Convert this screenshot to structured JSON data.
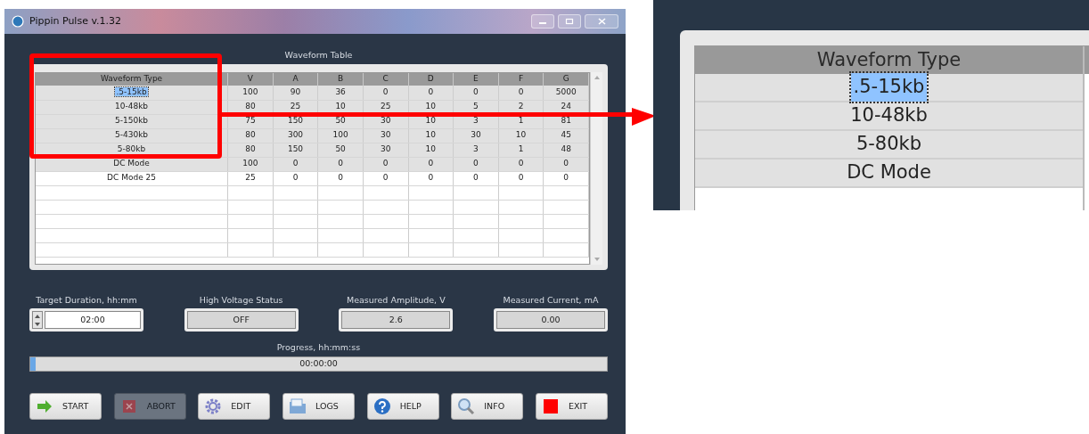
{
  "window": {
    "title": "Pippin Pulse v.1.32"
  },
  "waveform_table": {
    "title": "Waveform Table",
    "columns": [
      "Waveform Type",
      "V",
      "A",
      "B",
      "C",
      "D",
      "E",
      "F",
      "G"
    ],
    "rows": [
      {
        "cells": [
          ".5-15kb",
          "100",
          "90",
          "36",
          "0",
          "0",
          "0",
          "0",
          "5000"
        ],
        "selected": true,
        "shaded": true
      },
      {
        "cells": [
          "10-48kb",
          "80",
          "25",
          "10",
          "25",
          "10",
          "5",
          "2",
          "24"
        ],
        "selected": false,
        "shaded": true
      },
      {
        "cells": [
          "5-150kb",
          "75",
          "150",
          "50",
          "30",
          "10",
          "3",
          "1",
          "81"
        ],
        "selected": false,
        "shaded": true
      },
      {
        "cells": [
          "5-430kb",
          "80",
          "300",
          "100",
          "30",
          "10",
          "30",
          "10",
          "45"
        ],
        "selected": false,
        "shaded": true
      },
      {
        "cells": [
          "5-80kb",
          "80",
          "150",
          "50",
          "30",
          "10",
          "3",
          "1",
          "48"
        ],
        "selected": false,
        "shaded": true
      },
      {
        "cells": [
          "DC Mode",
          "100",
          "0",
          "0",
          "0",
          "0",
          "0",
          "0",
          "0"
        ],
        "selected": false,
        "shaded": true
      },
      {
        "cells": [
          "DC Mode 25",
          "25",
          "0",
          "0",
          "0",
          "0",
          "0",
          "0",
          "0"
        ],
        "selected": false,
        "shaded": false
      }
    ]
  },
  "status_fields": [
    {
      "label": "Target Duration, hh:mm",
      "value": "02:00",
      "kind": "spinner"
    },
    {
      "label": "High Voltage Status",
      "value": "OFF",
      "kind": "readout"
    },
    {
      "label": "Measured Amplitude, V",
      "value": "2.6",
      "kind": "readout"
    },
    {
      "label": "Measured Current, mA",
      "value": "0.00",
      "kind": "readout"
    }
  ],
  "progress": {
    "label": "Progress, hh:mm:ss",
    "value": "00:00:00",
    "level": 0.01
  },
  "buttons": [
    {
      "label": "START",
      "kind": "arrow",
      "disabled": false
    },
    {
      "label": "ABORT",
      "kind": "cross",
      "disabled": true
    },
    {
      "label": "EDIT",
      "kind": "gear",
      "disabled": false
    },
    {
      "label": "LOGS",
      "kind": "folder",
      "disabled": false
    },
    {
      "label": "HELP",
      "kind": "question",
      "disabled": false
    },
    {
      "label": "INFO",
      "kind": "magnifier",
      "disabled": false
    },
    {
      "label": "EXIT",
      "kind": "stop",
      "disabled": false
    }
  ],
  "zoom_inset": {
    "column": "Waveform Type",
    "rows": [
      {
        "text": ".5-15kb",
        "selected": true
      },
      {
        "text": "10-48kb",
        "selected": false
      },
      {
        "text": "5-80kb",
        "selected": false
      },
      {
        "text": "DC Mode",
        "selected": false
      }
    ]
  }
}
